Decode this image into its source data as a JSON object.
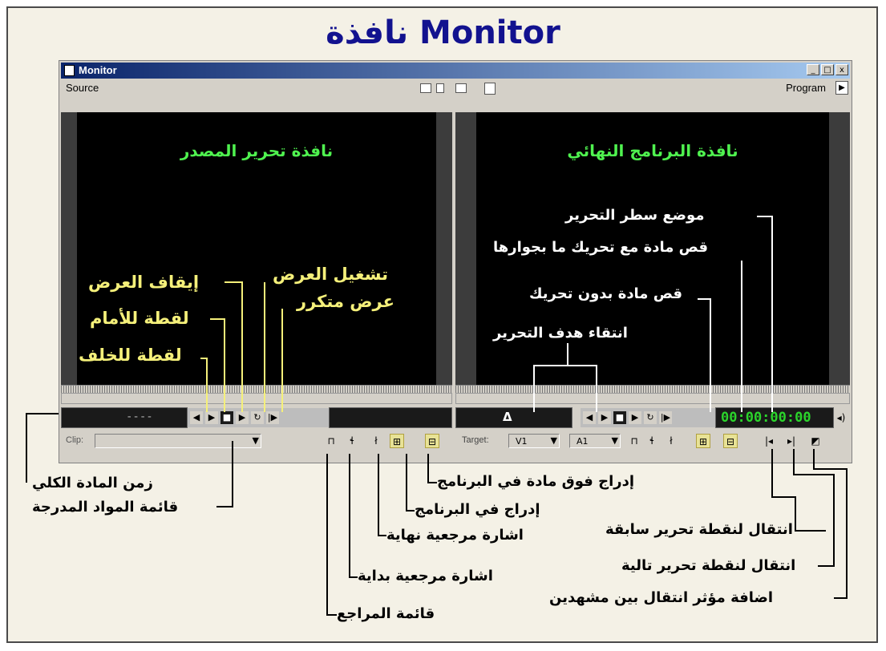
{
  "page_title": "نافذة Monitor",
  "window": {
    "title": "Monitor",
    "min_label": "_",
    "max_label": "□",
    "close_label": "x"
  },
  "menubar": {
    "source_label": "Source",
    "program_label": "Program",
    "menu_arrow": "▶"
  },
  "source_panel": {
    "title": "نافذة تحرير المصدر",
    "timecode": "----",
    "clip_label": "Clip:",
    "controls": [
      "◀",
      "▶",
      "■",
      "▶",
      "↻",
      "|▶"
    ]
  },
  "program_panel": {
    "title": "نافذة البرنامج النهائي",
    "delta": "Δ",
    "timecode": "00:00:00:00",
    "target_label": "Target:",
    "video_target": "V1",
    "audio_target": "A1",
    "controls": [
      "◀",
      "▶",
      "■",
      "▶",
      "↻",
      "|▶"
    ]
  },
  "annotations": {
    "stop": "إيقاف العرض",
    "play": "تشغيل العرض",
    "frame_forward": "لقطة للأمام",
    "loop": "عرض متكرر",
    "frame_back": "لقطة للخلف",
    "edit_line": "موضع سطر التحرير",
    "ripple_delete": "قص مادة مع تحريك ما بجوارها",
    "lift": "قص مادة بدون تحريك",
    "target_select": "انتقاء هدف التحرير",
    "clip_duration": "زمن المادة الكلي",
    "clip_list": "قائمة المواد المدرجة",
    "overlay": "إدراج فوق مادة في البرنامج",
    "insert": "إدراج في البرنامج",
    "mark_out": "اشارة مرجعية نهاية",
    "mark_in": "اشارة مرجعية بداية",
    "markers_menu": "قائمة المراجع",
    "prev_edit": "انتقال لنقطة تحرير سابقة",
    "next_edit": "انتقال لنقطة تحرير تالية",
    "add_transition": "اضافة مؤثر انتقال بين مشهدين"
  }
}
